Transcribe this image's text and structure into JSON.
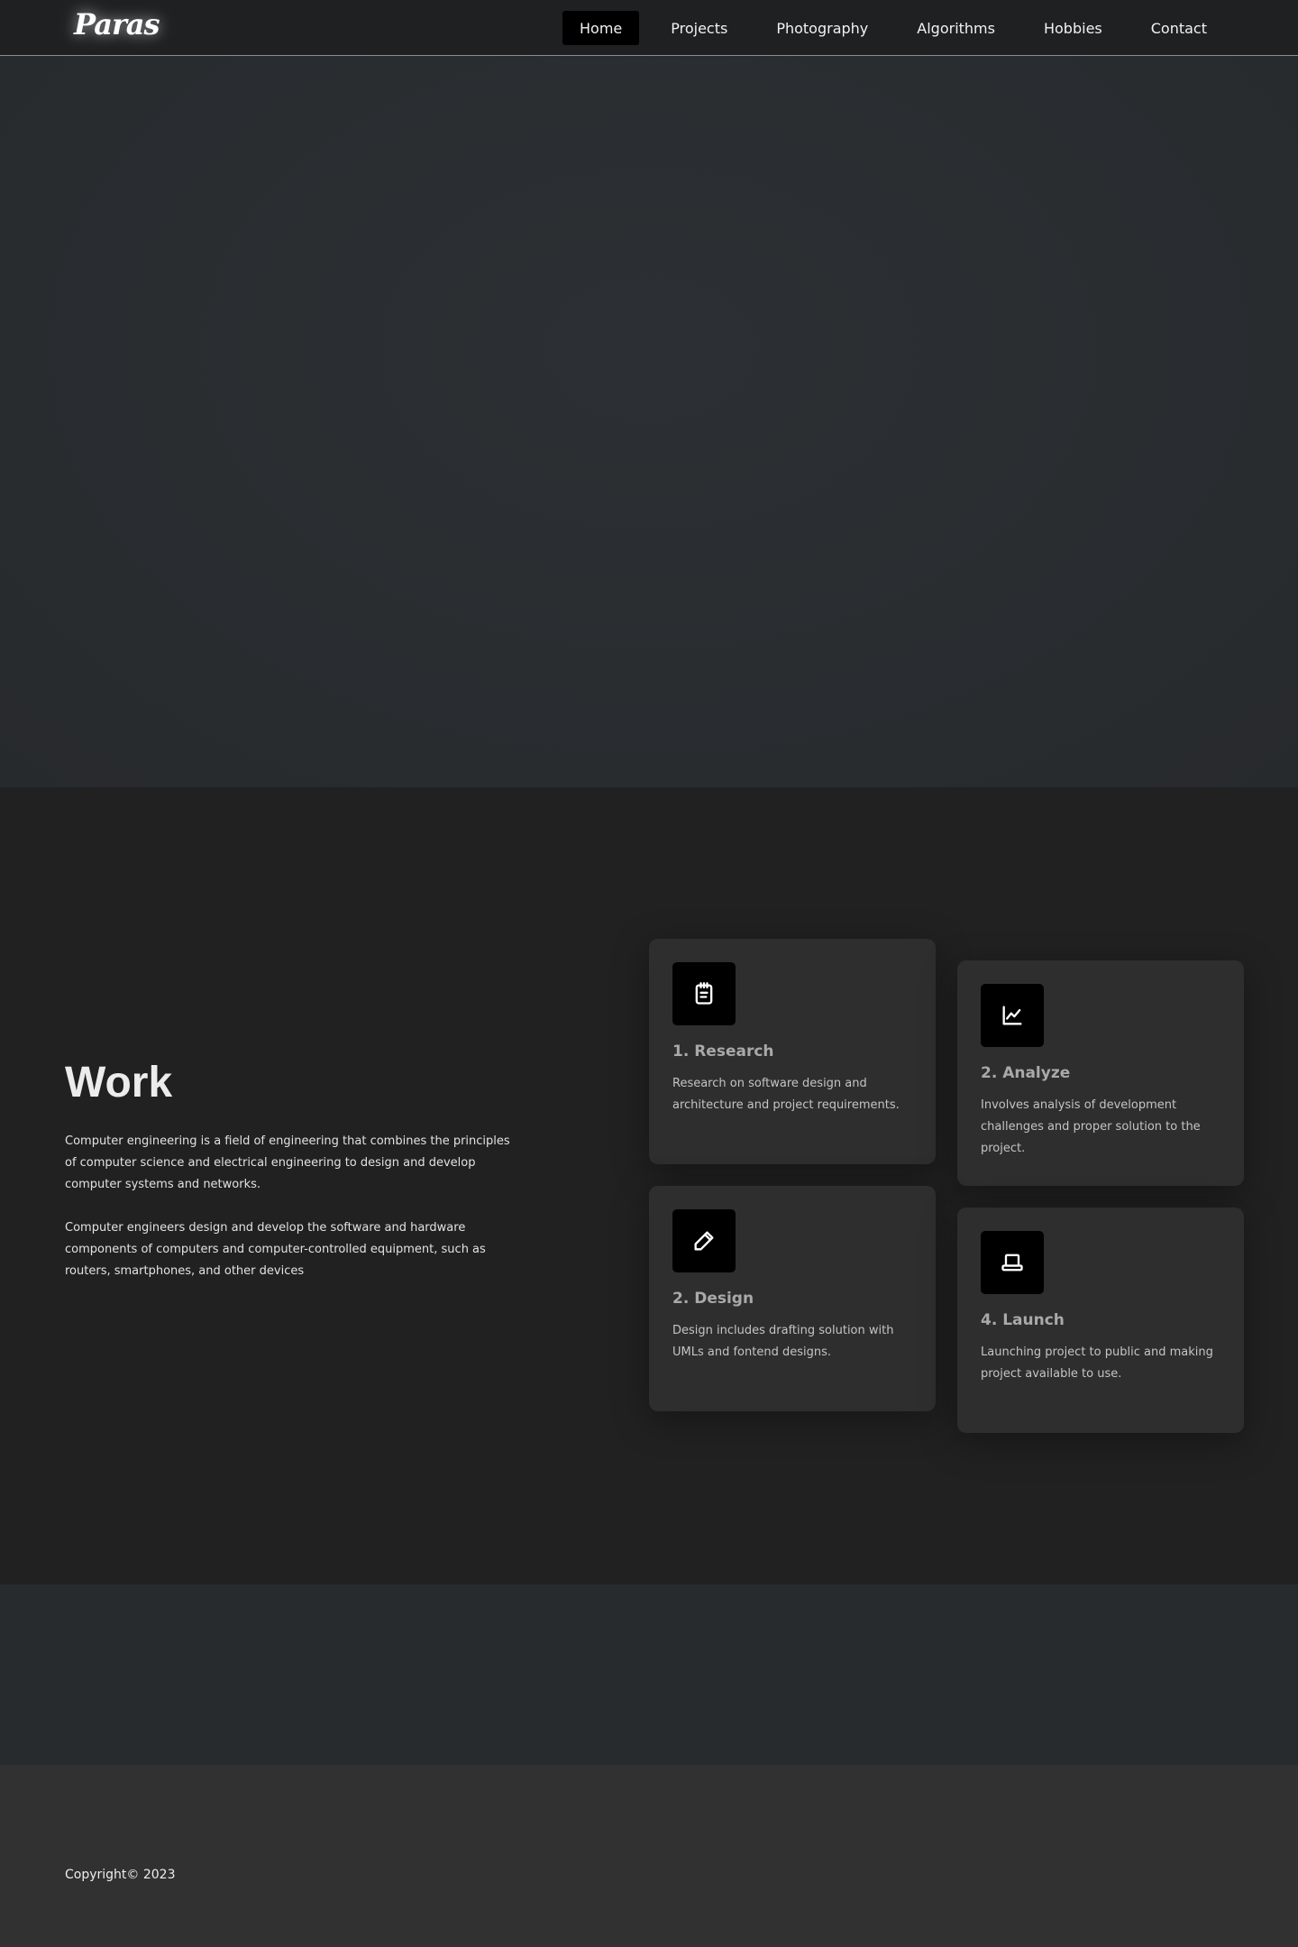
{
  "header": {
    "logo": "Paras",
    "nav": [
      {
        "label": "Home",
        "active": true
      },
      {
        "label": "Projects"
      },
      {
        "label": "Photography"
      },
      {
        "label": "Algorithms"
      },
      {
        "label": "Hobbies"
      },
      {
        "label": "Contact"
      }
    ]
  },
  "work": {
    "title": "Work",
    "paragraphs": [
      "Computer engineering is a field of engineering that combines the principles of computer science and electrical engineering to design and develop computer systems and networks.",
      "Computer engineers design and develop the software and hardware components of computers and computer-controlled equipment, such as routers, smartphones, and other devices"
    ],
    "cards": [
      {
        "title": "1. Research",
        "text": "Research on software design and architecture and project requirements.",
        "icon": "notepad-icon"
      },
      {
        "title": "2. Analyze",
        "text": "Involves analysis of development challenges and proper solution to the project.",
        "icon": "line-chart-icon"
      },
      {
        "title": "2. Design",
        "text": "Design includes drafting solution with UMLs and fontend designs.",
        "icon": "pencil-icon"
      },
      {
        "title": "4. Launch",
        "text": "Launching project to public and making project available to use.",
        "icon": "laptop-icon"
      }
    ]
  },
  "footer": {
    "copyright": "Copyright© 2023"
  },
  "colors": {
    "nav_bg": "#1f2022",
    "hero_bg": "#2a2e32",
    "work_bg": "#212121",
    "card_bg": "#2e2e2e",
    "icon_box_bg": "#000000",
    "footer_bg": "#313131"
  }
}
